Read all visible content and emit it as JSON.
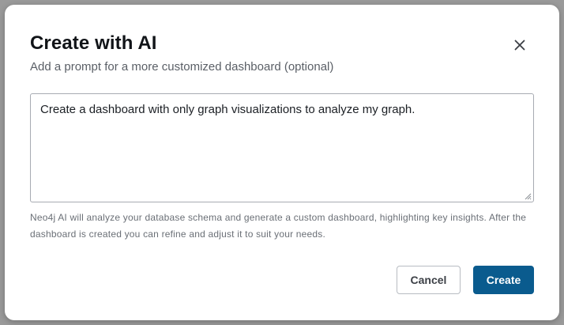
{
  "dialog": {
    "title": "Create with AI",
    "subtitle": "Add a prompt for a more customized dashboard (optional)",
    "close_icon": "close-icon"
  },
  "prompt": {
    "value": "Create a dashboard with only graph visualizations to analyze my graph."
  },
  "help_text": "Neo4j AI will analyze your database schema and generate a custom dashboard, highlighting key insights. After the dashboard is created you can refine and adjust it to suit your needs.",
  "buttons": {
    "cancel_label": "Cancel",
    "create_label": "Create"
  },
  "colors": {
    "primary": "#0a5b8e",
    "overlay": "#9a9a9a"
  }
}
